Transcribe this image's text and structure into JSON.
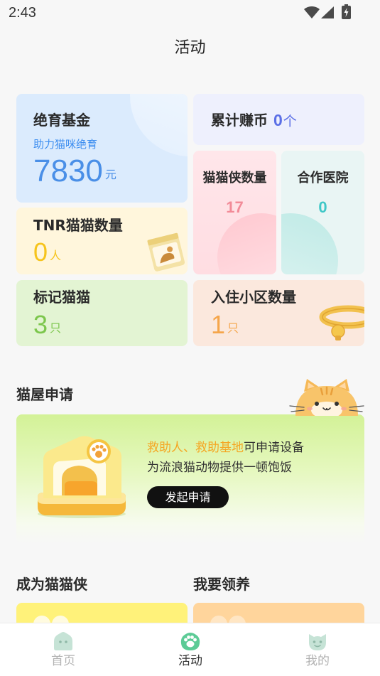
{
  "status_bar": {
    "time": "2:43",
    "icons": [
      "wifi-icon",
      "signal-icon",
      "battery-charging-icon"
    ]
  },
  "header": {
    "title": "活动"
  },
  "stats": {
    "fund": {
      "title": "绝育基金",
      "subtitle": "助力猫咪绝育",
      "value": "7830",
      "unit": "元"
    },
    "coins": {
      "title": "累计赚币",
      "value": "0",
      "unit": "个"
    },
    "heroes": {
      "title": "猫猫侠数量",
      "value": "17"
    },
    "hospitals": {
      "title": "合作医院",
      "value": "0"
    },
    "tnr": {
      "title": "TNR猫猫数量",
      "value": "0",
      "unit": "人",
      "image": "cat-food-bag"
    },
    "marked": {
      "title": "标记猫猫",
      "value": "3",
      "unit": "只"
    },
    "communities": {
      "title": "入住小区数量",
      "value": "1",
      "unit": "只",
      "image": "cat-collar"
    }
  },
  "cat_house": {
    "section_title": "猫屋申请",
    "line1_highlight": "救助人、救助基地",
    "line1_rest": "可申请设备",
    "line2": "为流浪猫动物提供一顿饱饭",
    "button_label": "发起申请",
    "image": "cat-house"
  },
  "sections": {
    "become_hero": {
      "title": "成为猫猫侠"
    },
    "adopt": {
      "title": "我要领养"
    }
  },
  "tab_bar": {
    "items": [
      {
        "label": "首页",
        "icon": "home-icon",
        "active": false
      },
      {
        "label": "活动",
        "icon": "paw-icon",
        "active": true
      },
      {
        "label": "我的",
        "icon": "cat-face-icon",
        "active": false
      }
    ]
  },
  "colors": {
    "fund_value": "#4a8fe7",
    "coins_value": "#5b6fe6",
    "heroes_value": "#f28b98",
    "hospitals_value": "#3fc7c7",
    "tnr_value": "#f6c41c",
    "marked_value": "#7cc64c",
    "communities_value": "#f5a64b",
    "highlight": "#f5a623",
    "active_tab": "#5ccb96"
  }
}
